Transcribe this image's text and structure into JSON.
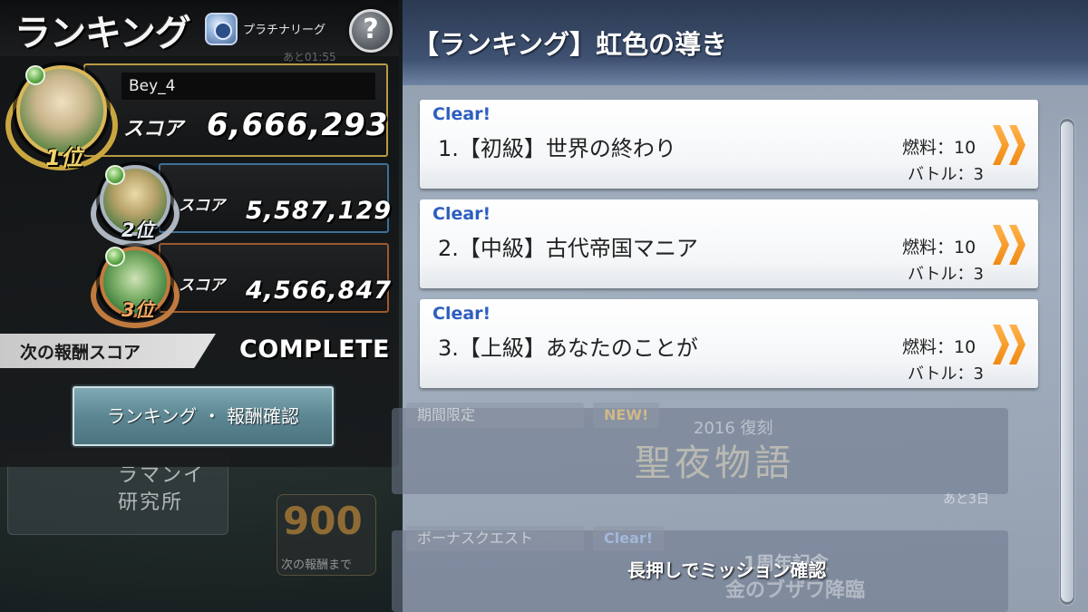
{
  "left_panel": {
    "title": "ランキング",
    "league_label": "プラチナリーグ",
    "help_label": "?",
    "countdown_ghost": "あと01:55",
    "rankings": [
      {
        "place": "1位",
        "name": "Bey_4",
        "score_label": "スコア",
        "score": "6,666,293"
      },
      {
        "place": "2位",
        "name": "",
        "score_label": "スコア",
        "score": "5,587,129"
      },
      {
        "place": "3位",
        "name": "",
        "score_label": "スコア",
        "score": "4,566,847"
      }
    ],
    "next_reward_label": "次の報酬スコア",
    "next_reward_value": "COMPLETE",
    "reward_button_label": "ランキング ・ 報酬確認"
  },
  "background": {
    "lab_text_1": "ラマンイ",
    "lab_text_2": "研究所",
    "reward_number": "900",
    "reward_caption": "次の報酬まで"
  },
  "right_panel": {
    "title": "【ランキング】虹色の導き",
    "quests": [
      {
        "status": "Clear!",
        "name": "1.【初級】世界の終わり",
        "fuel": "燃料：10",
        "battle": "バトル：3"
      },
      {
        "status": "Clear!",
        "name": "2.【中級】古代帝国マニア",
        "fuel": "燃料：10",
        "battle": "バトル：3"
      },
      {
        "status": "Clear!",
        "name": "3.【上級】あなたのことが",
        "fuel": "燃料：10",
        "battle": "バトル：3"
      }
    ],
    "banners": [
      {
        "tag": "期間限定",
        "badge": "NEW!",
        "year": "2016 復刻",
        "title": "聖夜物語",
        "remaining": "あと3日"
      },
      {
        "tag": "ボーナスクエスト",
        "badge": "Clear!",
        "title_line_1": "1周年記念",
        "title_line_2": "金のブザワ降臨"
      }
    ],
    "long_press_hint": "長押しでミッション確認"
  },
  "colors": {
    "gold_frame": "#b99b44",
    "silver_frame": "#3f6f95",
    "bronze_frame": "#9a5a2f",
    "clear_blue": "#2e5fbf",
    "chevron_orange": "#f08a14",
    "reward_button": "#5c8792"
  }
}
